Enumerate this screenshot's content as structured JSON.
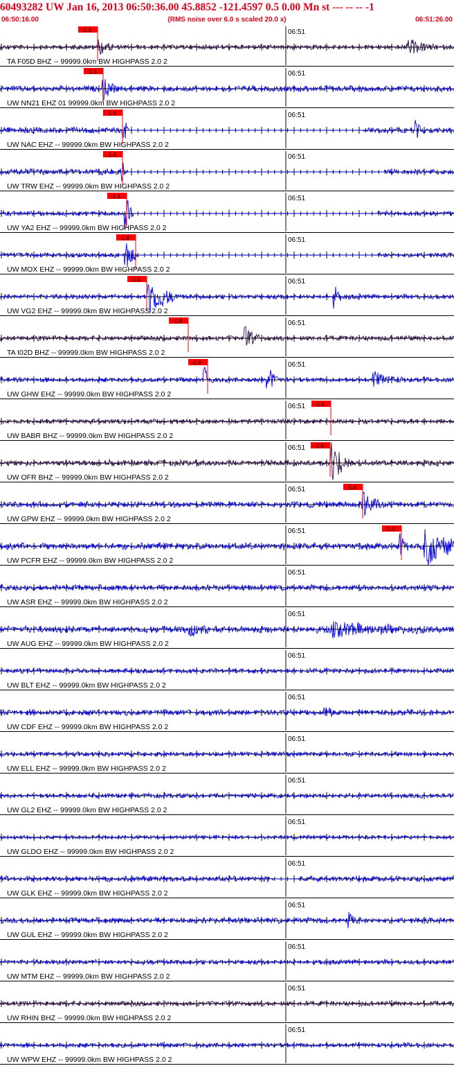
{
  "header": {
    "title": "60493282 UW Jan 16, 2013 06:50:36.00   45.8852 -121.4597  0.5 0.00 Mn st --- -- --  -1",
    "start_time": "06:50:16.00",
    "note": "(RMS noise over 6.0 s scaled 20.0 x)",
    "end_time": "06:51:26.00"
  },
  "colors": {
    "title": "#e0001a",
    "trace_blue": "#0000ee",
    "trace_dark": "#2a0a4a",
    "pick": "#ff0000",
    "axis": "#000000"
  },
  "chart_data": {
    "type": "line",
    "title": "60493282 UW Jan 16, 2013 06:50:36.00   45.8852 -121.4597  0.5 0.00 Mn st --- -- --  -1",
    "x_range": [
      "06:50:16.00",
      "06:51:26.00"
    ],
    "minute_mark_label": "06:51",
    "pick_label": "-1.4",
    "series": [
      {
        "name": "TA F05D BHZ -- 99999.0km BW  HIGHPASS  2.0  2",
        "color": "dark",
        "pick_x": 141,
        "amp": 4,
        "events": [
          {
            "x": 142,
            "amp": 12,
            "dur": 25
          },
          {
            "x": 590,
            "amp": 10,
            "dur": 40
          }
        ]
      },
      {
        "name": "UW NN21 EHZ 01 99999.0km BW  HIGHPASS  2.0  2",
        "color": "blue",
        "pick_x": 149,
        "amp": 5,
        "events": [
          {
            "x": 150,
            "amp": 14,
            "dur": 20
          }
        ]
      },
      {
        "name": "UW NAC EHZ -- 99999.0km BW  HIGHPASS  2.0  2",
        "color": "blue",
        "pick_x": 177,
        "amp": 5,
        "gaps": [
          [
            185,
            525
          ]
        ],
        "events": [
          {
            "x": 178,
            "amp": 18,
            "dur": 8
          },
          {
            "x": 601,
            "amp": 14,
            "dur": 8
          }
        ]
      },
      {
        "name": "UW TRW EHZ -- 99999.0km BW  HIGHPASS  2.0  2",
        "color": "blue",
        "pick_x": 177,
        "amp": 5,
        "gaps": [
          [
            185,
            555
          ]
        ],
        "events": [
          {
            "x": 176,
            "amp": 14,
            "dur": 8
          }
        ]
      },
      {
        "name": "UW YA2 EHZ -- 99999.0km BW  HIGHPASS  2.0  2",
        "color": "blue",
        "pick_x": 183,
        "amp": 4,
        "gaps": [
          [
            193,
            545
          ]
        ],
        "events": [
          {
            "x": 182,
            "amp": 30,
            "dur": 10
          }
        ]
      },
      {
        "name": "UW MOX EHZ -- 99999.0km BW  HIGHPASS  2.0  2",
        "color": "blue",
        "pick_x": 196,
        "amp": 4,
        "gaps": [
          [
            200,
            545
          ]
        ],
        "events": [
          {
            "x": 182,
            "amp": 22,
            "dur": 14
          }
        ]
      },
      {
        "name": "UW VG2 EHZ -- 99999.0km BW  HIGHPASS  2.0  2",
        "color": "blue",
        "pick_x": 212,
        "amp": 4,
        "events": [
          {
            "x": 215,
            "amp": 30,
            "dur": 40
          },
          {
            "x": 484,
            "amp": 16,
            "dur": 8
          }
        ]
      },
      {
        "name": "TA I02D BHZ -- 99999.0km BW  HIGHPASS  2.0  2",
        "color": "dark",
        "pick_x": 272,
        "amp": 4,
        "events": [
          {
            "x": 355,
            "amp": 14,
            "dur": 20
          }
        ]
      },
      {
        "name": "UW GHW EHZ -- 99999.0km BW  HIGHPASS  2.0  2",
        "color": "blue",
        "pick_x": 300,
        "amp": 4,
        "events": [
          {
            "x": 296,
            "amp": 18,
            "dur": 12
          },
          {
            "x": 387,
            "amp": 22,
            "dur": 14
          },
          {
            "x": 540,
            "amp": 10,
            "dur": 45
          }
        ]
      },
      {
        "name": "UW BABR BHZ -- 99999.0km BW  HIGHPASS  2.0  2",
        "color": "dark",
        "pick_x": 478,
        "amp": 4,
        "events": []
      },
      {
        "name": "UW OFR BHZ -- 99999.0km BW  HIGHPASS  2.0  2",
        "color": "dark",
        "pick_x": 477,
        "amp": 5,
        "events": [
          {
            "x": 480,
            "amp": 28,
            "dur": 30
          }
        ]
      },
      {
        "name": "UW GPW EHZ -- 99999.0km BW  HIGHPASS  2.0  2",
        "color": "blue",
        "pick_x": 524,
        "amp": 5,
        "events": [
          {
            "x": 525,
            "amp": 20,
            "dur": 25
          }
        ]
      },
      {
        "name": "UW PCFR EHZ -- 99999.0km BW  HIGHPASS  2.0  2",
        "color": "blue",
        "pick_x": 580,
        "amp": 6,
        "events": [
          {
            "x": 578,
            "amp": 14,
            "dur": 12
          },
          {
            "x": 615,
            "amp": 30,
            "dur": 55
          }
        ]
      },
      {
        "name": "UW ASR EHZ -- 99999.0km BW  HIGHPASS  2.0  2",
        "color": "blue",
        "amp": 5,
        "events": []
      },
      {
        "name": "UW AUG EHZ -- 99999.0km BW  HIGHPASS  2.0  2",
        "color": "blue",
        "amp": 6,
        "events": [
          {
            "x": 275,
            "amp": 9,
            "dur": 25
          },
          {
            "x": 480,
            "amp": 8,
            "dur": 150
          }
        ]
      },
      {
        "name": "UW BLT EHZ -- 99999.0km BW  HIGHPASS  2.0  2",
        "color": "blue",
        "amp": 4,
        "events": []
      },
      {
        "name": "UW CDF EHZ -- 99999.0km BW  HIGHPASS  2.0  2",
        "color": "blue",
        "amp": 5,
        "events": [
          {
            "x": 470,
            "amp": 9,
            "dur": 20
          }
        ]
      },
      {
        "name": "UW ELL EHZ -- 99999.0km BW  HIGHPASS  2.0  2",
        "color": "blue",
        "amp": 4,
        "events": []
      },
      {
        "name": "UW GL2 EHZ -- 99999.0km BW  HIGHPASS  2.0  2",
        "color": "blue",
        "amp": 4,
        "events": []
      },
      {
        "name": "UW GLDO EHZ -- 99999.0km BW  HIGHPASS  2.0  2",
        "color": "blue",
        "amp": 3,
        "events": []
      },
      {
        "name": "UW GLK EHZ -- 99999.0km BW  HIGHPASS  2.0  2",
        "color": "blue",
        "amp": 5,
        "gaps": [
          [
            395,
            430
          ]
        ],
        "events": []
      },
      {
        "name": "UW GUL EHZ -- 99999.0km BW  HIGHPASS  2.0  2",
        "color": "blue",
        "amp": 5,
        "events": [
          {
            "x": 505,
            "amp": 10,
            "dur": 10
          }
        ]
      },
      {
        "name": "UW MTM EHZ -- 99999.0km BW  HIGHPASS  2.0  2",
        "color": "blue",
        "amp": 4,
        "events": []
      },
      {
        "name": "UW RHIN BHZ -- 99999.0km BW  HIGHPASS  2.0  2",
        "color": "dark",
        "amp": 4,
        "events": []
      },
      {
        "name": "UW WPW EHZ -- 99999.0km BW  HIGHPASS  2.0  2",
        "color": "blue",
        "amp": 4,
        "events": []
      }
    ]
  }
}
